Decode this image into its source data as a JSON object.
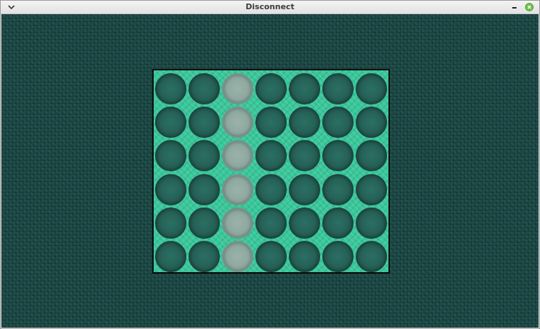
{
  "window": {
    "title": "Disconnect",
    "menu_icon": "chevron-down-icon",
    "minimize_icon": "minimize-icon",
    "close_icon": "close-icon",
    "close_color": "#6cbf4a"
  },
  "game": {
    "board": {
      "rows": 6,
      "columns": 7,
      "highlighted_column": 2,
      "board_color": "#38c79a",
      "slot_color": "#255f56",
      "highlight_color": "#8da89f",
      "background_color": "#1d4a47"
    }
  }
}
